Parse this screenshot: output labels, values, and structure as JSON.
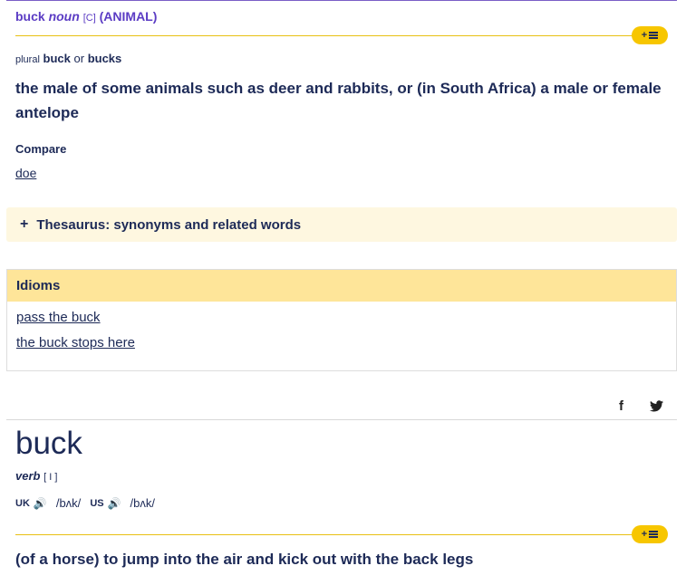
{
  "sense1": {
    "headword": "buck",
    "pos": "noun",
    "grammar": "[C]",
    "guideword": "(ANIMAL)",
    "add_button_label": "+",
    "plural_label": "plural",
    "plural_form1": "buck",
    "plural_or": "or",
    "plural_form2": "bucks",
    "definition": "the male of some animals such as deer and rabbits, or (in South Africa) a male or female antelope",
    "compare_label": "Compare",
    "compare_link": "doe"
  },
  "thesaurus": {
    "icon": "+",
    "label": "Thesaurus: synonyms and related words"
  },
  "idioms": {
    "title": "Idioms",
    "items": [
      "pass the buck",
      "the buck stops here"
    ]
  },
  "share": {
    "facebook": "f",
    "twitter": "twitter-icon"
  },
  "entry2": {
    "headword": "buck",
    "pos": "verb",
    "grammar": "[ I ]",
    "uk_label": "UK",
    "us_label": "US",
    "uk_ipa": "/bʌk/",
    "us_ipa": "/bʌk/",
    "add_button_label": "+",
    "definition": "(of a horse) to jump into the air and kick out with the back legs"
  },
  "colors": {
    "accent": "#5b3cc4",
    "text": "#1d2a57",
    "yellow": "#f7c600"
  }
}
